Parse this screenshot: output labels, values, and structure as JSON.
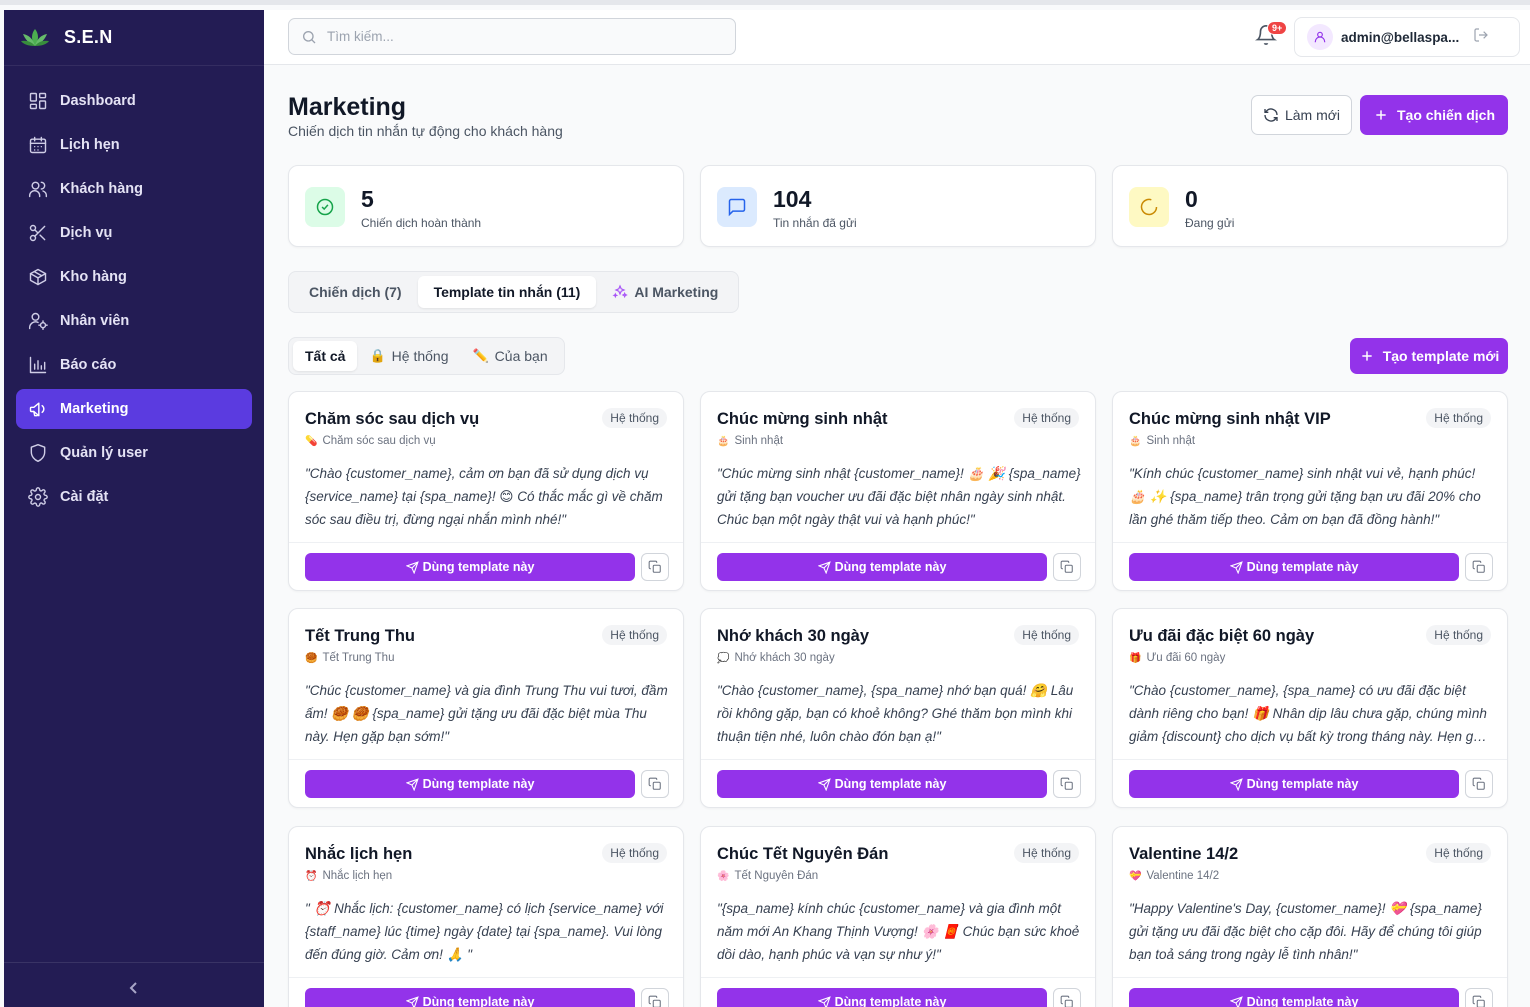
{
  "brand": {
    "name": "S.E.N"
  },
  "sidebar": {
    "items": [
      {
        "label": "Dashboard",
        "icon": "dashboard-icon",
        "active": false
      },
      {
        "label": "Lịch hẹn",
        "icon": "calendar-icon",
        "active": false
      },
      {
        "label": "Khách hàng",
        "icon": "users-icon",
        "active": false
      },
      {
        "label": "Dịch vụ",
        "icon": "scissors-icon",
        "active": false
      },
      {
        "label": "Kho hàng",
        "icon": "package-icon",
        "active": false
      },
      {
        "label": "Nhân viên",
        "icon": "staff-icon",
        "active": false
      },
      {
        "label": "Báo cáo",
        "icon": "bar-chart-icon",
        "active": false
      },
      {
        "label": "Marketing",
        "icon": "megaphone-icon",
        "active": true
      },
      {
        "label": "Quản lý user",
        "icon": "shield-icon",
        "active": false
      },
      {
        "label": "Cài đặt",
        "icon": "gear-icon",
        "active": false
      }
    ]
  },
  "topbar": {
    "search_placeholder": "Tìm kiếm...",
    "notification_badge": "9+",
    "user_email": "admin@bellaspa..."
  },
  "page": {
    "title": "Marketing",
    "subtitle": "Chiến dịch tin nhắn tự động cho khách hàng",
    "refresh_label": "Làm mới",
    "create_campaign_label": "Tạo chiến dịch"
  },
  "stats": [
    {
      "value": "5",
      "caption": "Chiến dịch hoàn thành",
      "icon": "check-circle-icon",
      "color": "#16a34a",
      "bg": "#dcfce7"
    },
    {
      "value": "104",
      "caption": "Tin nhắn đã gửi",
      "icon": "message-icon",
      "color": "#2563eb",
      "bg": "#dbeafe"
    },
    {
      "value": "0",
      "caption": "Đang gửi",
      "icon": "loader-icon",
      "color": "#ca8a04",
      "bg": "#fef9c3"
    }
  ],
  "tabs": [
    {
      "label": "Chiến dịch (7)",
      "active": false
    },
    {
      "label": "Template tin nhắn (11)",
      "active": true
    },
    {
      "label": "AI Marketing",
      "active": false,
      "icon": "sparkles-icon"
    }
  ],
  "filters": [
    {
      "label": "Tất cả",
      "emoji": "",
      "active": true
    },
    {
      "label": "Hệ thống",
      "emoji": "🔒",
      "active": false
    },
    {
      "label": "Của bạn",
      "emoji": "✏️",
      "active": false
    }
  ],
  "new_template_label": "Tạo template mới",
  "use_label": "Dùng template này",
  "templates": [
    {
      "title": "Chăm sóc sau dịch vụ",
      "tag": "Hệ thống",
      "emoji": "💊",
      "category": "Chăm sóc sau dịch vụ",
      "body": "\"Chào {customer_name}, cảm ơn bạn đã sử dụng dịch vụ {service_name} tại {spa_name}! 😊 Có thắc mắc gì về chăm sóc sau điều trị, đừng ngại nhắn mình nhé!\""
    },
    {
      "title": "Chúc mừng sinh nhật",
      "tag": "Hệ thống",
      "emoji": "🎂",
      "category": "Sinh nhật",
      "body": "\"Chúc mừng sinh nhật {customer_name}! 🎂 🎉 {spa_name} gửi tặng bạn voucher ưu đãi đặc biệt nhân ngày sinh nhật. Chúc bạn một ngày thật vui và hạnh phúc!\""
    },
    {
      "title": "Chúc mừng sinh nhật VIP",
      "tag": "Hệ thống",
      "emoji": "🎂",
      "category": "Sinh nhật",
      "body": "\"Kính chúc {customer_name} sinh nhật vui vẻ, hạnh phúc! 🎂 ✨ {spa_name} trân trọng gửi tặng bạn ưu đãi 20% cho lần ghé thăm tiếp theo. Cảm ơn bạn đã đồng hành!\""
    },
    {
      "title": "Tết Trung Thu",
      "tag": "Hệ thống",
      "emoji": "🥮",
      "category": "Tết Trung Thu",
      "body": "\"Chúc {customer_name} và gia đình Trung Thu vui tươi, đầm ấm! 🥮 🥮 {spa_name} gửi tặng ưu đãi đặc biệt mùa Thu này. Hẹn gặp bạn sớm!\""
    },
    {
      "title": "Nhớ khách 30 ngày",
      "tag": "Hệ thống",
      "emoji": "💭",
      "category": "Nhớ khách 30 ngày",
      "body": "\"Chào {customer_name}, {spa_name} nhớ bạn quá! 🤗 Lâu rồi không gặp, bạn có khoẻ không? Ghé thăm bọn mình khi thuận tiện nhé, luôn chào đón bạn ạ!\""
    },
    {
      "title": "Ưu đãi đặc biệt 60 ngày",
      "tag": "Hệ thống",
      "emoji": "🎁",
      "category": "Ưu đãi 60 ngày",
      "body": "\"Chào {customer_name}, {spa_name} có ưu đãi đặc biệt dành riêng cho bạn! 🎁 Nhân dịp lâu chưa gặp, chúng mình giảm {discount} cho dịch vụ bất kỳ trong tháng này. Hẹn gặp bạn!\""
    },
    {
      "title": "Nhắc lịch hẹn",
      "tag": "Hệ thống",
      "emoji": "⏰",
      "category": "Nhắc lịch hẹn",
      "body": "\" ⏰ Nhắc lịch: {customer_name} có lịch {service_name} với {staff_name} lúc {time} ngày {date} tại {spa_name}. Vui lòng đến đúng giờ. Cảm ơn! 🙏 \""
    },
    {
      "title": "Chúc Tết Nguyên Đán",
      "tag": "Hệ thống",
      "emoji": "🌸",
      "category": "Tết Nguyên Đán",
      "body": "\"{spa_name} kính chúc {customer_name} và gia đình một năm mới An Khang Thịnh Vượng! 🌸 🧧 Chúc bạn sức khoẻ dồi dào, hạnh phúc và vạn sự như ý!\""
    },
    {
      "title": "Valentine 14/2",
      "tag": "Hệ thống",
      "emoji": "💝",
      "category": "Valentine 14/2",
      "body": "\"Happy Valentine's Day, {customer_name}! 💝 {spa_name} gửi tặng ưu đãi đặc biệt cho cặp đôi. Hãy để chúng tôi giúp bạn toả sáng trong ngày lễ tình nhân!\""
    }
  ]
}
